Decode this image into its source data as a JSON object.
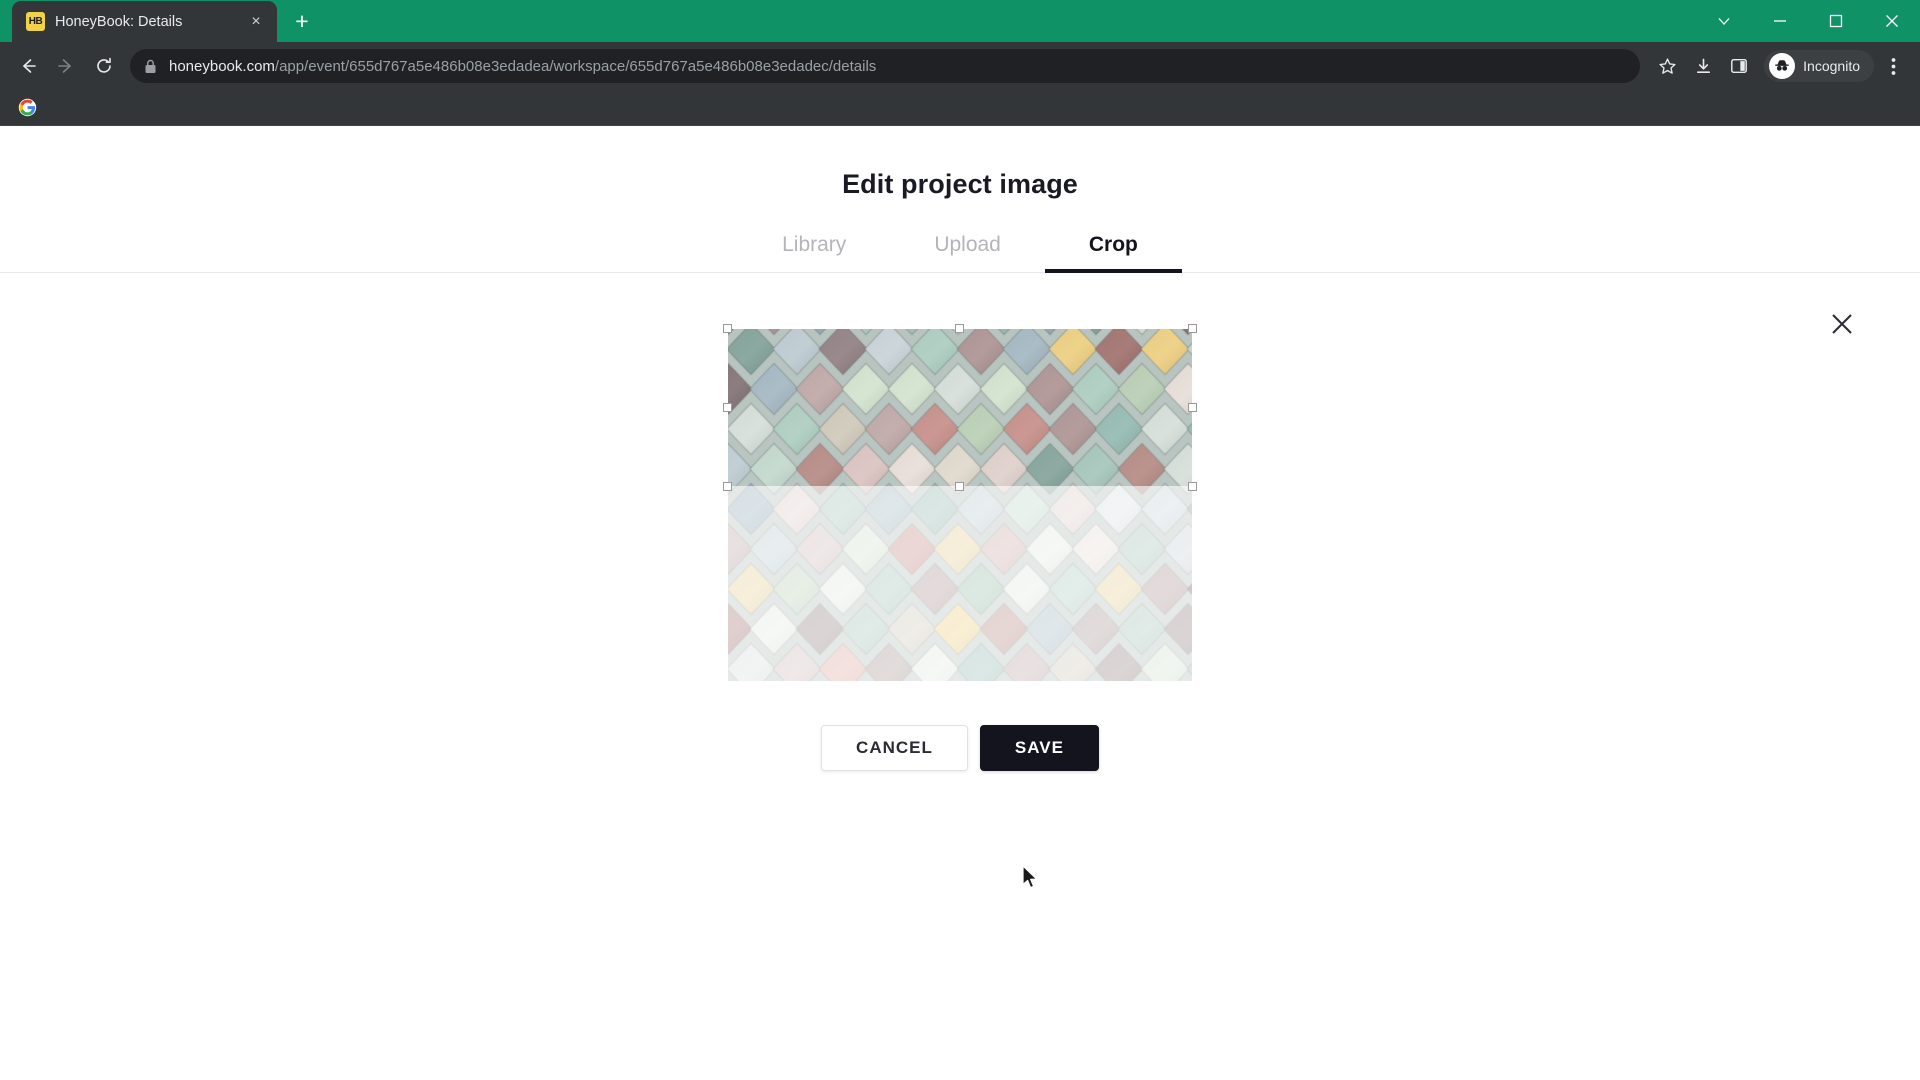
{
  "browser": {
    "tab": {
      "title": "HoneyBook: Details",
      "favicon_text": "HB",
      "close_label": "×"
    },
    "new_tab_label": "+",
    "window_controls": {
      "tab_search": "tab-search",
      "minimize": "minimize",
      "maximize": "maximize",
      "close": "close"
    },
    "nav": {
      "back": "back-icon",
      "forward": "forward-icon",
      "reload": "reload-icon"
    },
    "omnibox": {
      "lock_icon": "lock-icon",
      "url_domain": "honeybook.com",
      "url_path": "/app/event/655d767a5e486b08e3edadea/workspace/655d767a5e486b08e3edadec/details",
      "url_full": "honeybook.com/app/event/655d767a5e486b08e3edadea/workspace/655d767a5e486b08e3edadec/details"
    },
    "toolbar_icons": {
      "bookmark": "star-icon",
      "downloads": "download-icon",
      "side_panel": "side-panel-icon",
      "menu": "three-dot-menu-icon"
    },
    "incognito": {
      "label": "Incognito",
      "icon": "incognito-icon"
    },
    "bookmarks_bar": {
      "items": [
        {
          "name": "google-bookmark",
          "icon": "google-g-icon"
        }
      ]
    },
    "colors": {
      "titlebar": "#0f9266",
      "chrome": "#323639",
      "omnibox": "#202124"
    }
  },
  "modal": {
    "title": "Edit project image",
    "close_icon": "close-icon",
    "tabs": [
      {
        "label": "Library",
        "active": false
      },
      {
        "label": "Upload",
        "active": false
      },
      {
        "label": "Crop",
        "active": true
      }
    ],
    "crop": {
      "image_alt": "pastel-diamond-shingles",
      "handles": [
        "top-left",
        "top-center",
        "top-right",
        "middle-left",
        "middle-right",
        "bottom-left",
        "bottom-center",
        "bottom-right"
      ]
    },
    "buttons": {
      "cancel": "CANCEL",
      "save": "SAVE"
    },
    "colors": {
      "active_tab": "#14141e",
      "inactive_tab": "#b4b4bb",
      "save_bg": "#14141e"
    }
  }
}
